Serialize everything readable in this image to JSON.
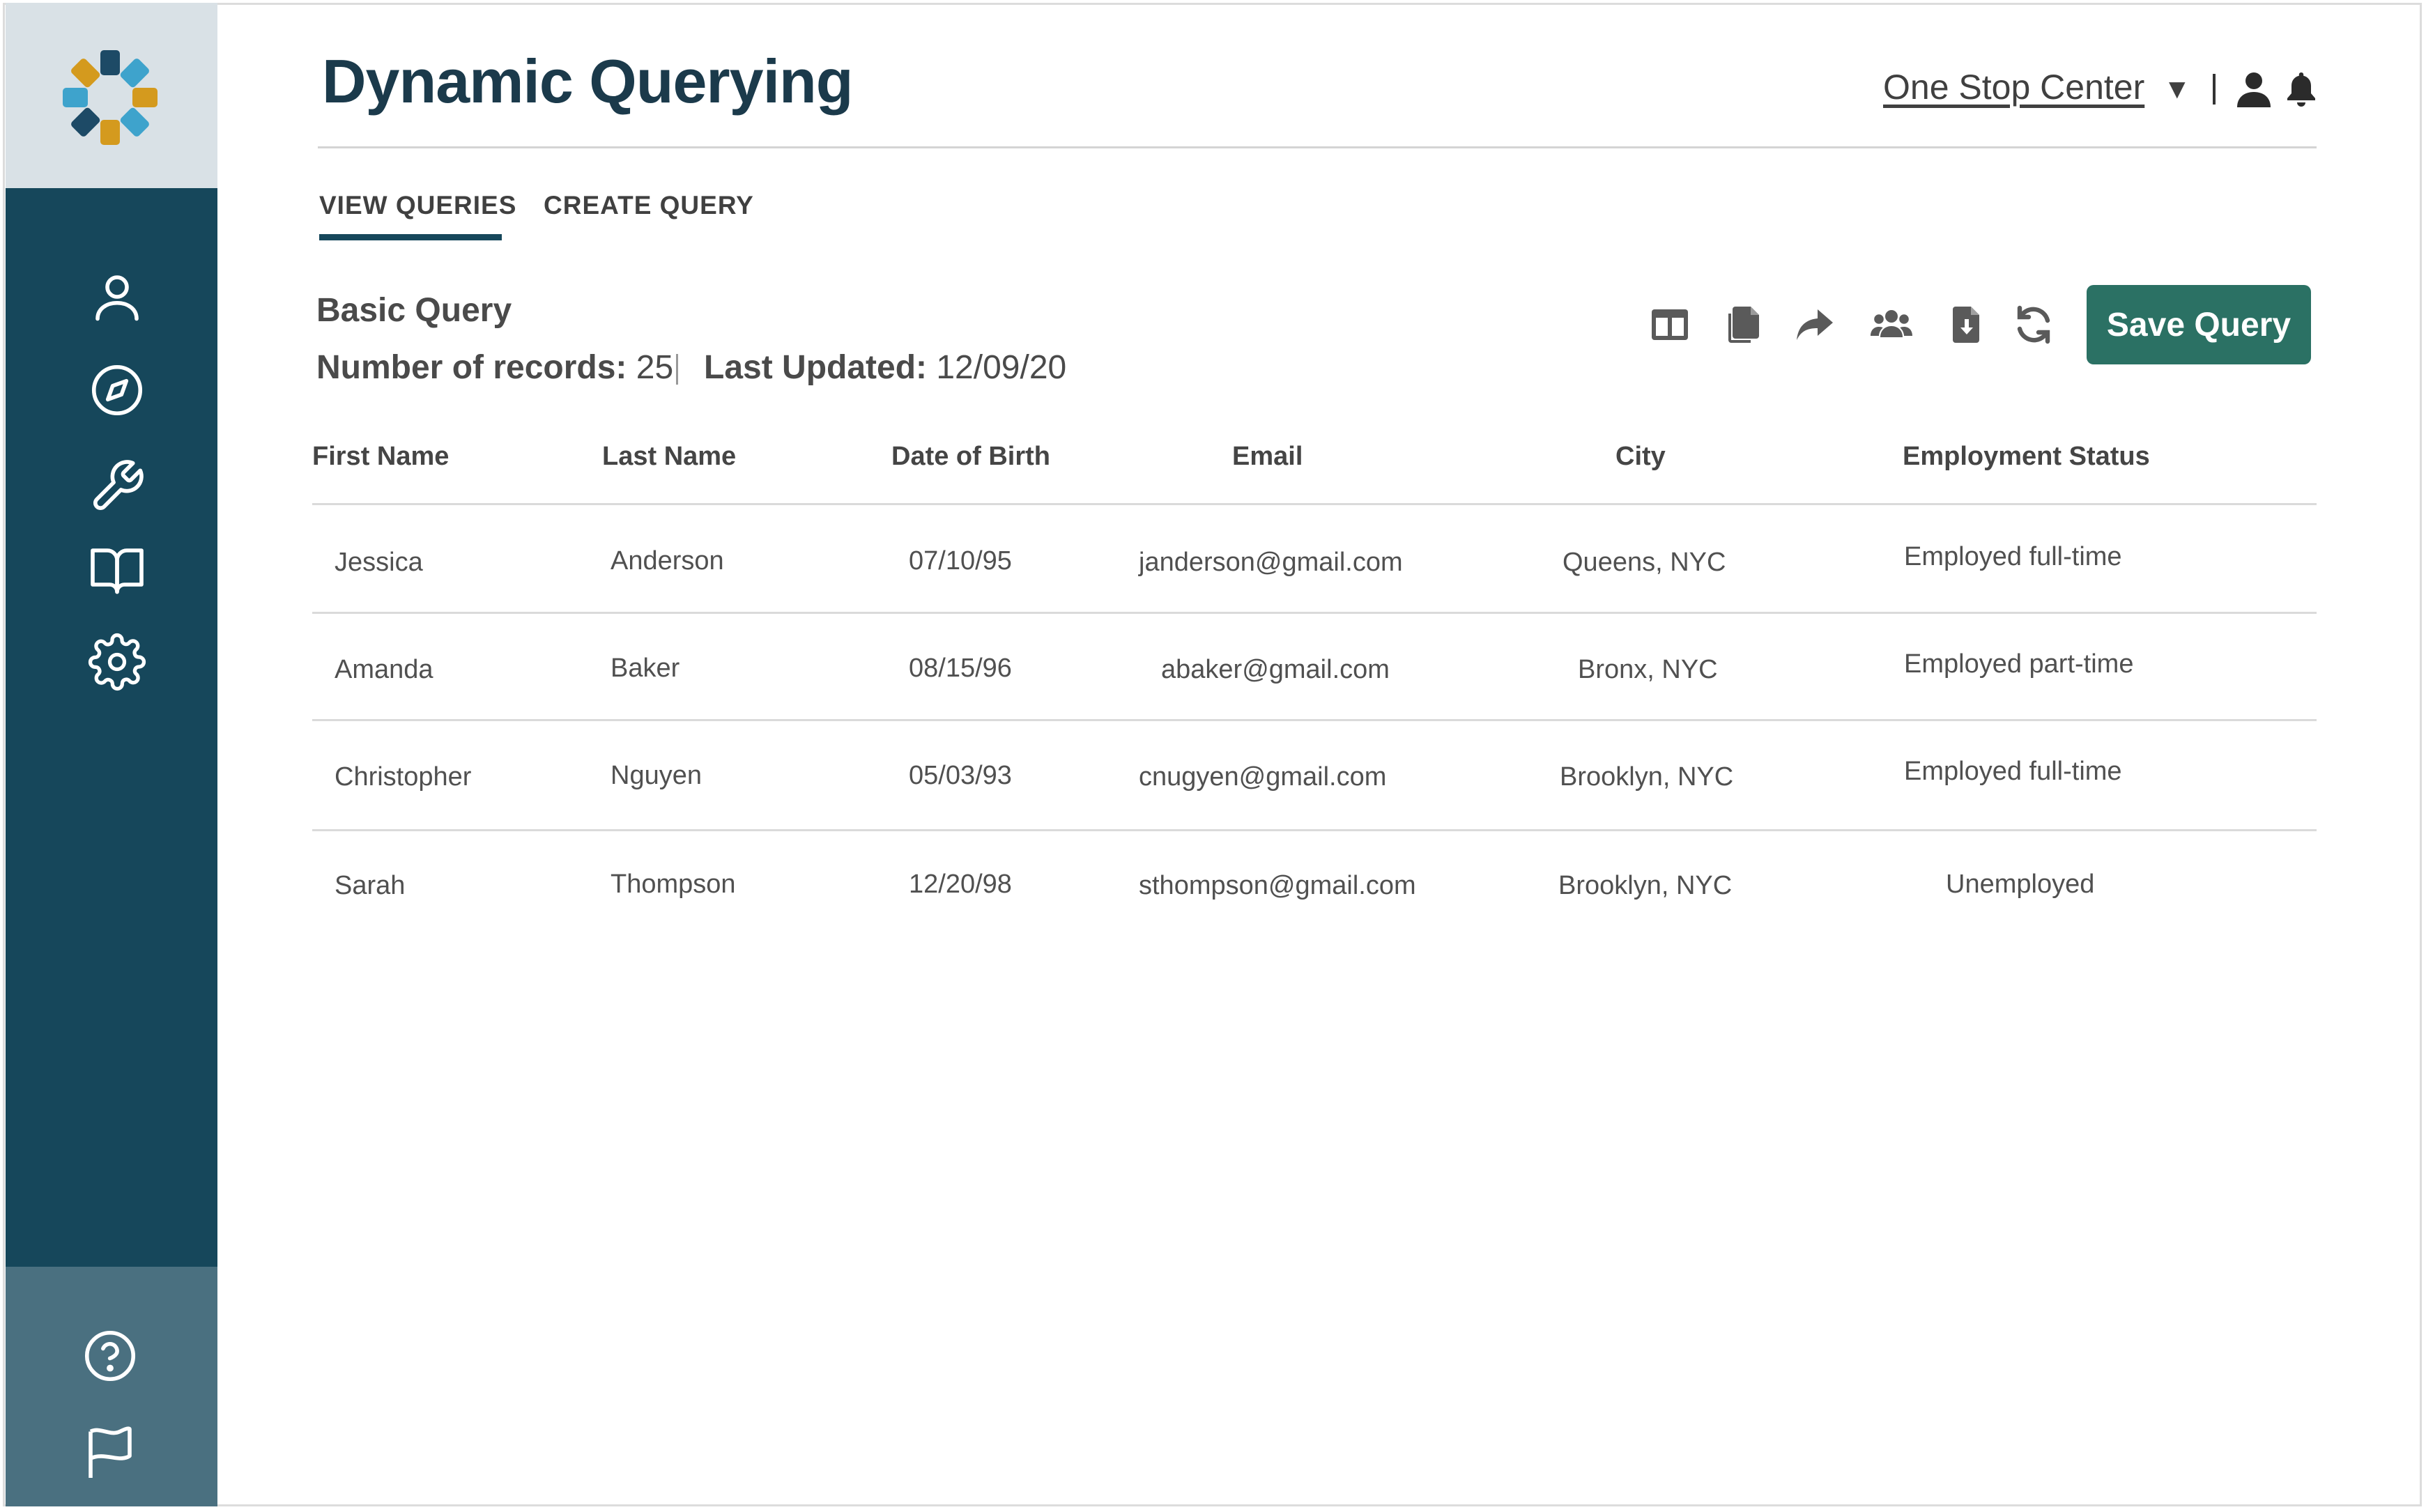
{
  "app": {
    "title": "Dynamic Querying",
    "organization": "One Stop Center",
    "colors": {
      "sidebar": "#16475b",
      "sidebar_bottom": "#4a7080",
      "accent_button": "#2b7164",
      "logo_box": "#d9e1e6"
    }
  },
  "sidebar": {
    "items": [
      {
        "name": "profile",
        "icon": "user-icon"
      },
      {
        "name": "explore",
        "icon": "compass-icon"
      },
      {
        "name": "tools",
        "icon": "wrench-icon"
      },
      {
        "name": "resources",
        "icon": "book-icon"
      },
      {
        "name": "settings",
        "icon": "gear-icon"
      }
    ],
    "bottom_items": [
      {
        "name": "help",
        "icon": "help-circle-icon"
      },
      {
        "name": "report",
        "icon": "flag-icon"
      }
    ]
  },
  "tabs": [
    {
      "label": "VIEW QUERIES",
      "active": true
    },
    {
      "label": "CREATE QUERY",
      "active": false
    }
  ],
  "query": {
    "name": "Basic Query",
    "records_label": "Number of records:",
    "records_value": "25",
    "updated_label": "Last Updated:",
    "updated_value": "12/09/20"
  },
  "toolbar": {
    "icons": [
      "columns-icon",
      "copy-icon",
      "share-icon",
      "users-icon",
      "download-file-icon",
      "refresh-icon"
    ],
    "save_label": "Save Query"
  },
  "table": {
    "columns": [
      "First Name",
      "Last Name",
      "Date of Birth",
      "Email",
      "City",
      "Employment Status"
    ],
    "rows": [
      [
        "Jessica",
        "Anderson",
        "07/10/95",
        "janderson@gmail.com",
        "Queens, NYC",
        "Employed full-time"
      ],
      [
        "Amanda",
        "Baker",
        "08/15/96",
        "abaker@gmail.com",
        "Bronx, NYC",
        "Employed part-time"
      ],
      [
        "Christopher",
        "Nguyen",
        "05/03/93",
        "cnugyen@gmail.com",
        "Brooklyn, NYC",
        "Employed full-time"
      ],
      [
        "Sarah",
        "Thompson",
        "12/20/98",
        "sthompson@gmail.com",
        "Brooklyn, NYC",
        "Unemployed"
      ]
    ]
  }
}
